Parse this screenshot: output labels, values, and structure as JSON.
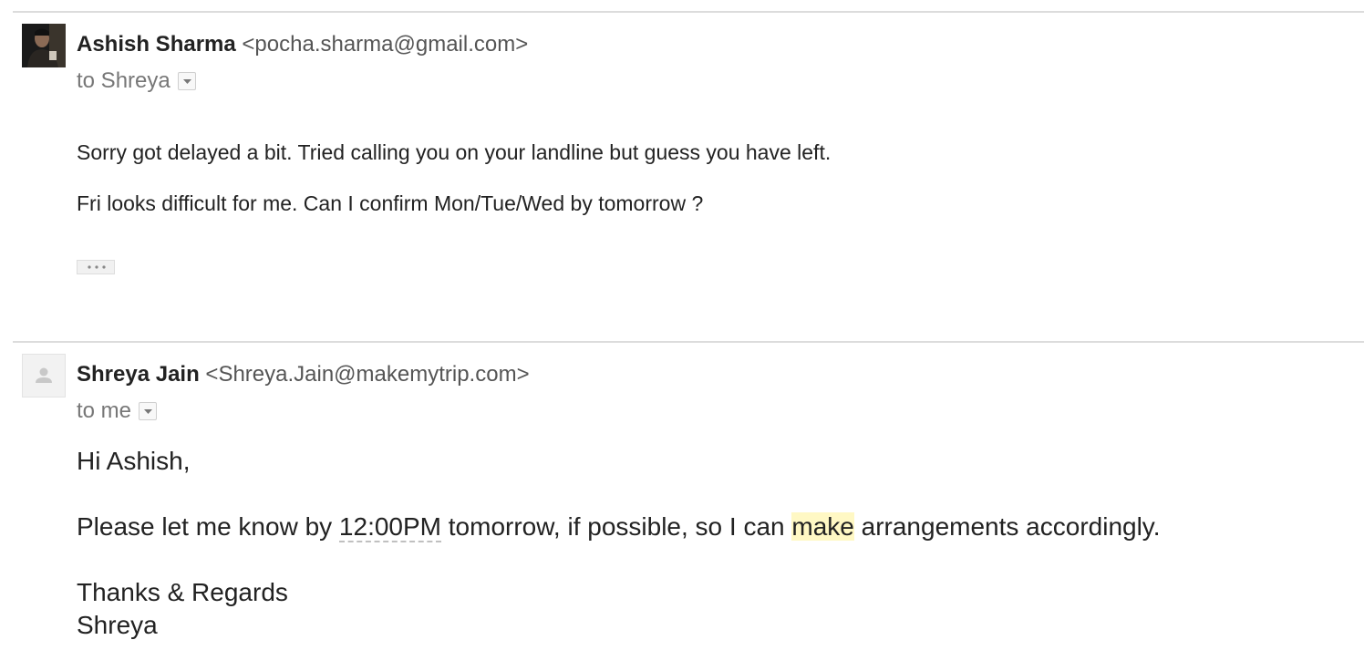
{
  "thread": {
    "messages": [
      {
        "sender_name": "Ashish Sharma",
        "sender_email": "<pocha.sharma@gmail.com>",
        "recipient_text": "to Shreya",
        "avatar": "profile-photo",
        "body_lines": [
          "Sorry got delayed a bit. Tried calling you on your landline but guess you have left.",
          "Fri looks difficult for me. Can I confirm Mon/Tue/Wed by tomorrow ?"
        ],
        "trimmed_content_icon": "ellipsis-icon"
      },
      {
        "sender_name": "Shreya Jain",
        "sender_email": "<Shreya.Jain@makemytrip.com>",
        "recipient_text": "to me",
        "avatar": "default-person-icon",
        "greeting": "Hi Ashish,",
        "request": {
          "before_time": "Please let me know by ",
          "time": "12:00PM",
          "middle": " tomorrow, if possible, so I can ",
          "highlighted_word": "make",
          "after": " arrangements accordingly."
        },
        "signoff": "Thanks & Regards",
        "signature": "Shreya"
      }
    ]
  },
  "colors": {
    "divider": "#dcdcdc",
    "highlight": "#fff8c4",
    "muted_text": "#777777"
  }
}
